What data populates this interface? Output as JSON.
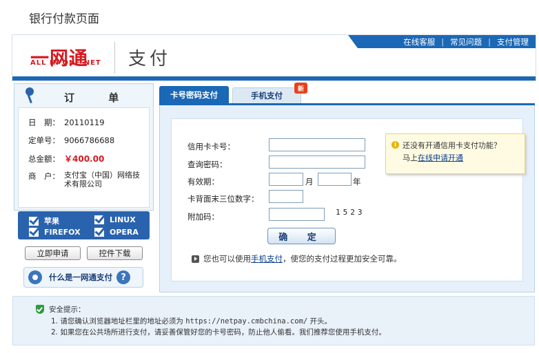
{
  "page_title": "银行付款页面",
  "header": {
    "nav": [
      "在线客服",
      "常见问题",
      "支付管理"
    ],
    "nav_sep": "|",
    "logo_main": "一网通",
    "logo_sub": "ALL IN ONE NET",
    "logo_pay": "支付",
    "colors": {
      "brand_blue": "#1b68b6",
      "logo_red": "#d71920"
    }
  },
  "order": {
    "title": "订 单",
    "date_label": "日　期：",
    "date_value": "20110119",
    "order_no_label": "定单号：",
    "order_no_value": "9066786688",
    "amount_label": "总金额：",
    "amount_value": "￥400.00",
    "merchant_label": "商　户：",
    "merchant_value_1": "支付宝（中国）网络技",
    "merchant_value_2": "术有限公司"
  },
  "browsers": [
    "苹果",
    "LINUX",
    "FIREFOX",
    "OPERA"
  ],
  "buttons": {
    "apply": "立即申请",
    "download": "控件下载",
    "what_is": "什么是一网通支付",
    "confirm": "确 定"
  },
  "tabs": {
    "card": "卡号密码支付",
    "mobile": "手机支付",
    "new_badge": "新"
  },
  "form": {
    "card_no_label": "信用卡卡号：",
    "query_pwd_label": "查询密码：",
    "expiry_label": "有效期：",
    "month_suffix": "月",
    "year_suffix": "年",
    "cvv_label": "卡背面末三位数字：",
    "captcha_label": "附加码：",
    "captcha_value": "1523"
  },
  "tip": {
    "prefix": "您也可以使用",
    "link": "手机支付",
    "suffix": "，使您的支付过程更加安全可靠。"
  },
  "notice": {
    "line1": "还没有开通信用卡支付功能？",
    "line2_prefix": "马上",
    "line2_link": "在线申请开通"
  },
  "security": {
    "title": "安全提示：",
    "item1_prefix": "1. 请您确认浏览器地址栏里的地址必须为 ",
    "item1_url": "https://netpay.cmbchina.com/",
    "item1_suffix": " 开头。",
    "item2": "2. 如果您在公共场所进行支付，请妥善保管好您的卡号密码，防止他人偷看。我们推荐您使用手机支付。"
  }
}
